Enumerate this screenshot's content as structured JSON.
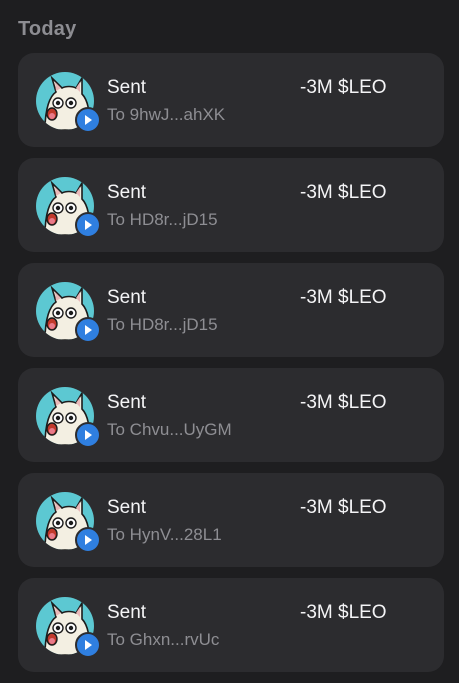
{
  "section": {
    "title": "Today"
  },
  "colors": {
    "background": "#1e1e20",
    "card": "#2c2c2f",
    "avatar_bg": "#5cc8d2",
    "send_badge": "#2f7fe0",
    "secondary_text": "#8e8e93"
  },
  "icons": {
    "avatar": "token-cat-avatar",
    "badge": "send-arrow-icon"
  },
  "transactions": [
    {
      "title": "Sent",
      "address": "To 9hwJ...ahXK",
      "amount": "-3M $LEO"
    },
    {
      "title": "Sent",
      "address": "To HD8r...jD15",
      "amount": "-3M $LEO"
    },
    {
      "title": "Sent",
      "address": "To HD8r...jD15",
      "amount": "-3M $LEO"
    },
    {
      "title": "Sent",
      "address": "To Chvu...UyGM",
      "amount": "-3M $LEO"
    },
    {
      "title": "Sent",
      "address": "To HynV...28L1",
      "amount": "-3M $LEO"
    },
    {
      "title": "Sent",
      "address": "To Ghxn...rvUc",
      "amount": "-3M $LEO"
    }
  ]
}
